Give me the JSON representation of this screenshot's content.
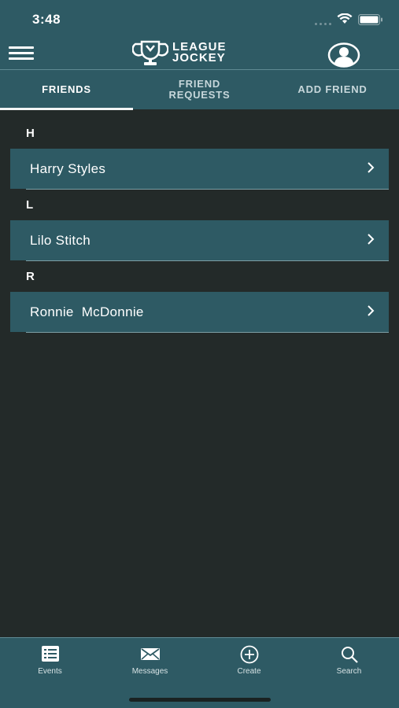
{
  "status": {
    "time": "3:48"
  },
  "header": {
    "logo_line1": "LEAGUE",
    "logo_line2": "JOCKEY"
  },
  "tabs": [
    {
      "label": "FRIENDS",
      "active": true
    },
    {
      "label": "FRIEND\nREQUESTS",
      "active": false
    },
    {
      "label": "ADD FRIEND",
      "active": false
    }
  ],
  "sections": [
    {
      "letter": "H",
      "friends": [
        "Harry Styles"
      ]
    },
    {
      "letter": "L",
      "friends": [
        "Lilo Stitch"
      ]
    },
    {
      "letter": "R",
      "friends": [
        "Ronnie  McDonnie"
      ]
    }
  ],
  "bottom_nav": [
    {
      "label": "Events",
      "icon": "list-icon"
    },
    {
      "label": "Messages",
      "icon": "envelope-icon"
    },
    {
      "label": "Create",
      "icon": "plus-circle-icon"
    },
    {
      "label": "Search",
      "icon": "search-icon"
    }
  ],
  "colors": {
    "header_bg": "#2e5a64",
    "page_bg": "#232a29",
    "row_bg": "#2e5a64"
  }
}
